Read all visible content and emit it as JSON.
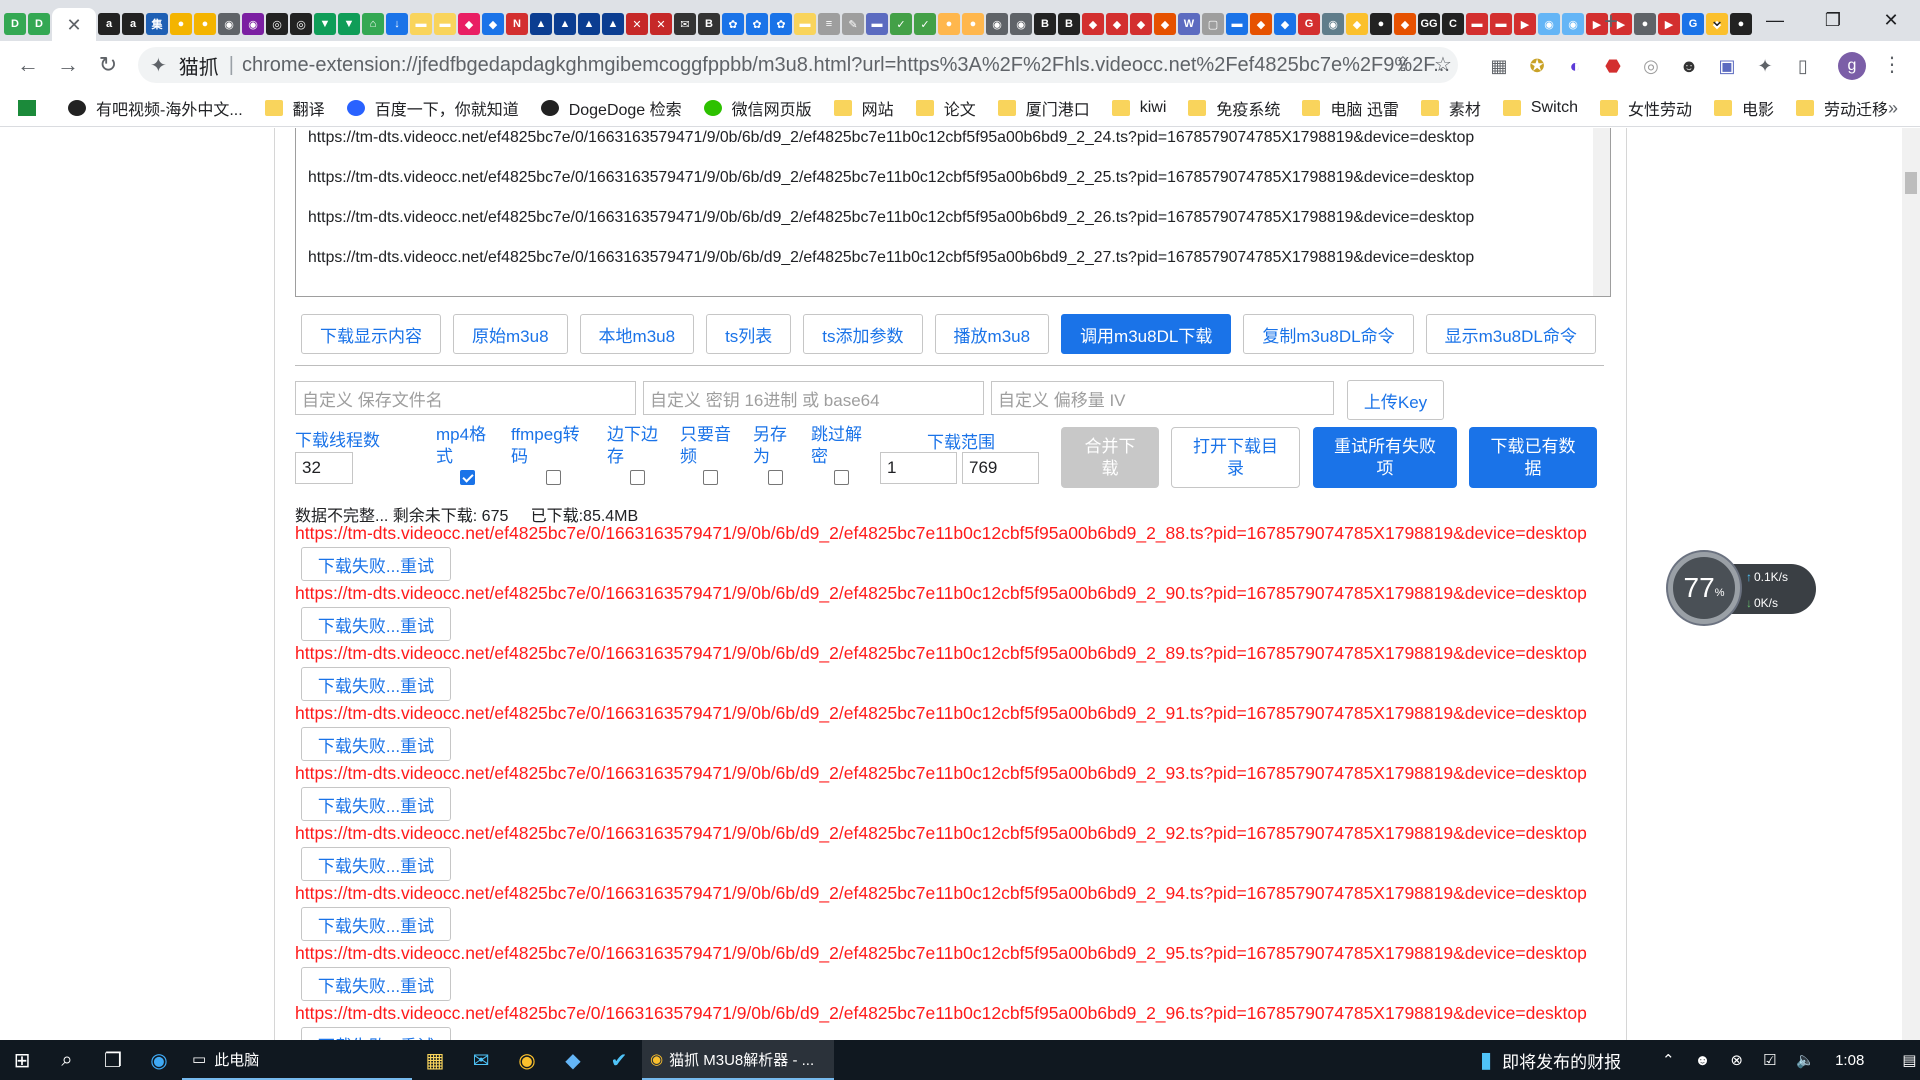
{
  "browser": {
    "active_tab_close": "✕",
    "new_tab": "+",
    "window_controls": [
      "⌄",
      "—",
      "❐",
      "✕"
    ],
    "address": {
      "ext_label": "猫抓",
      "separator": "|",
      "url": "chrome-extension://jfedfbgedapdagkghmgibemcoggfppbb/m3u8.html?url=https%3A%2F%2Fhls.videocc.net%2Fef4825bc7e%2F9%2F..."
    },
    "profile_initial": "g",
    "bookmarks": [
      {
        "label": "",
        "icon": "stocks-icon"
      },
      {
        "label": "有吧视频-海外中文...",
        "icon": "site-icon"
      },
      {
        "label": "翻译",
        "icon": "folder-icon"
      },
      {
        "label": "百度一下，你就知道",
        "icon": "baidu-icon"
      },
      {
        "label": "DogeDoge 检索",
        "icon": "site-icon"
      },
      {
        "label": "微信网页版",
        "icon": "wechat-icon"
      },
      {
        "label": "网站",
        "icon": "folder-icon"
      },
      {
        "label": "论文",
        "icon": "folder-icon"
      },
      {
        "label": "厦门港口",
        "icon": "folder-icon"
      },
      {
        "label": "kiwi",
        "icon": "folder-icon"
      },
      {
        "label": "免疫系统",
        "icon": "folder-icon"
      },
      {
        "label": "电脑 迅雷",
        "icon": "folder-icon"
      },
      {
        "label": "素材",
        "icon": "folder-icon"
      },
      {
        "label": "Switch",
        "icon": "folder-icon"
      },
      {
        "label": "女性劳动",
        "icon": "folder-icon"
      },
      {
        "label": "电影",
        "icon": "folder-icon"
      },
      {
        "label": "劳动迁移",
        "icon": "folder-icon"
      }
    ],
    "bookmarks_more": "»"
  },
  "textarea_lines": [
    "https://tm-dts.videocc.net/ef4825bc7e/0/1663163579471/9/0b/6b/d9_2/ef4825bc7e11b0c12cbf5f95a00b6bd9_2_24.ts?pid=1678579074785X1798819&device=desktop",
    "https://tm-dts.videocc.net/ef4825bc7e/0/1663163579471/9/0b/6b/d9_2/ef4825bc7e11b0c12cbf5f95a00b6bd9_2_25.ts?pid=1678579074785X1798819&device=desktop",
    "https://tm-dts.videocc.net/ef4825bc7e/0/1663163579471/9/0b/6b/d9_2/ef4825bc7e11b0c12cbf5f95a00b6bd9_2_26.ts?pid=1678579074785X1798819&device=desktop",
    "https://tm-dts.videocc.net/ef4825bc7e/0/1663163579471/9/0b/6b/d9_2/ef4825bc7e11b0c12cbf5f95a00b6bd9_2_27.ts?pid=1678579074785X1798819&device=desktop"
  ],
  "buttons": [
    "下载显示内容",
    "原始m3u8",
    "本地m3u8",
    "ts列表",
    "ts添加参数",
    "播放m3u8",
    "调用m3u8DL下载",
    "复制m3u8DL命令",
    "显示m3u8DL命令"
  ],
  "inputs": {
    "filename_placeholder": "自定义 保存文件名",
    "key_placeholder": "自定义 密钥 16进制 或 base64",
    "iv_placeholder": "自定义 偏移量 IV",
    "upload_key": "上传Key"
  },
  "options": {
    "threads_label": "下载线程数",
    "threads_value": "32",
    "mp4_label_1": "mp4格",
    "mp4_label_2": "式",
    "mp4_checked": true,
    "ffmpeg_label_1": "ffmpeg转",
    "ffmpeg_label_2": "码",
    "ffmpeg_checked": false,
    "stream_label_1": "边下边",
    "stream_label_2": "存",
    "stream_checked": false,
    "audio_label_1": "只要音",
    "audio_label_2": "频",
    "audio_checked": false,
    "saveas_label_1": "另存",
    "saveas_label_2": "为",
    "saveas_checked": false,
    "skipdec_label_1": "跳过解",
    "skipdec_label_2": "密",
    "skipdec_checked": false,
    "range_label": "下载范围",
    "range_start": "1",
    "range_end": "769"
  },
  "actions": {
    "merge_1": "合并下",
    "merge_2": "载",
    "open_dir_1": "打开下载目",
    "open_dir_2": "录",
    "retry_all_1": "重试所有失败",
    "retry_all_2": "项",
    "download_existing_1": "下载已有数",
    "download_existing_2": "据"
  },
  "status": "数据不完整... 剩余未下载: 675     已下载:85.4MB",
  "failed_segments": [
    {
      "url": "https://tm-dts.videocc.net/ef4825bc7e/0/1663163579471/9/0b/6b/d9_2/ef4825bc7e11b0c12cbf5f95a00b6bd9_2_88.ts?pid=1678579074785X1798819&device=desktop",
      "retry": "下载失败...重试"
    },
    {
      "url": "https://tm-dts.videocc.net/ef4825bc7e/0/1663163579471/9/0b/6b/d9_2/ef4825bc7e11b0c12cbf5f95a00b6bd9_2_90.ts?pid=1678579074785X1798819&device=desktop",
      "retry": "下载失败...重试"
    },
    {
      "url": "https://tm-dts.videocc.net/ef4825bc7e/0/1663163579471/9/0b/6b/d9_2/ef4825bc7e11b0c12cbf5f95a00b6bd9_2_89.ts?pid=1678579074785X1798819&device=desktop",
      "retry": "下载失败...重试"
    },
    {
      "url": "https://tm-dts.videocc.net/ef4825bc7e/0/1663163579471/9/0b/6b/d9_2/ef4825bc7e11b0c12cbf5f95a00b6bd9_2_91.ts?pid=1678579074785X1798819&device=desktop",
      "retry": "下载失败...重试"
    },
    {
      "url": "https://tm-dts.videocc.net/ef4825bc7e/0/1663163579471/9/0b/6b/d9_2/ef4825bc7e11b0c12cbf5f95a00b6bd9_2_93.ts?pid=1678579074785X1798819&device=desktop",
      "retry": "下载失败...重试"
    },
    {
      "url": "https://tm-dts.videocc.net/ef4825bc7e/0/1663163579471/9/0b/6b/d9_2/ef4825bc7e11b0c12cbf5f95a00b6bd9_2_92.ts?pid=1678579074785X1798819&device=desktop",
      "retry": "下载失败...重试"
    },
    {
      "url": "https://tm-dts.videocc.net/ef4825bc7e/0/1663163579471/9/0b/6b/d9_2/ef4825bc7e11b0c12cbf5f95a00b6bd9_2_94.ts?pid=1678579074785X1798819&device=desktop",
      "retry": "下载失败...重试"
    },
    {
      "url": "https://tm-dts.videocc.net/ef4825bc7e/0/1663163579471/9/0b/6b/d9_2/ef4825bc7e11b0c12cbf5f95a00b6bd9_2_95.ts?pid=1678579074785X1798819&device=desktop",
      "retry": "下载失败...重试"
    },
    {
      "url": "https://tm-dts.videocc.net/ef4825bc7e/0/1663163579471/9/0b/6b/d9_2/ef4825bc7e11b0c12cbf5f95a00b6bd9_2_96.ts?pid=1678579074785X1798819&device=desktop",
      "retry": "下载失败...重试"
    }
  ],
  "speed_widget": {
    "percent": "77",
    "percent_unit": "%",
    "up": "0.1K/s",
    "down": "0K/s"
  },
  "taskbar": {
    "explorer_label": "此电脑",
    "chrome_label": "猫抓 M3U8解析器 - ...",
    "news_label": "即将发布的财报",
    "time": "1:08"
  },
  "colors": {
    "accent": "#1a73e8",
    "error": "#ff1a1a",
    "taskbar": "#101820"
  }
}
